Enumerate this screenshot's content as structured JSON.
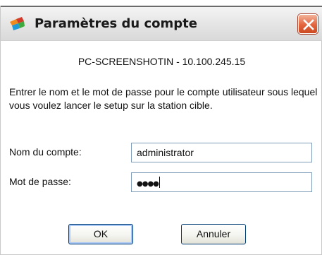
{
  "window": {
    "title": "Paramètres du compte",
    "icon": "app-colored-blocks-icon",
    "close_icon": "close-icon"
  },
  "host_label": "PC-SCREENSHOTIN - 10.100.245.15",
  "instructions": "Entrer le nom et le mot de passe pour le compte utilisateur sous lequel vous voulez lancer le setup sur la station cible.",
  "form": {
    "account_label": "Nom du compte:",
    "account_value": "administrator",
    "password_label": "Mot de passe:",
    "password_mask": "●●●●"
  },
  "buttons": {
    "ok_label": "OK",
    "cancel_label": "Annuler"
  },
  "colors": {
    "close_button": "#e2653e",
    "field_border": "#7f9db9",
    "button_border": "#003c74"
  }
}
